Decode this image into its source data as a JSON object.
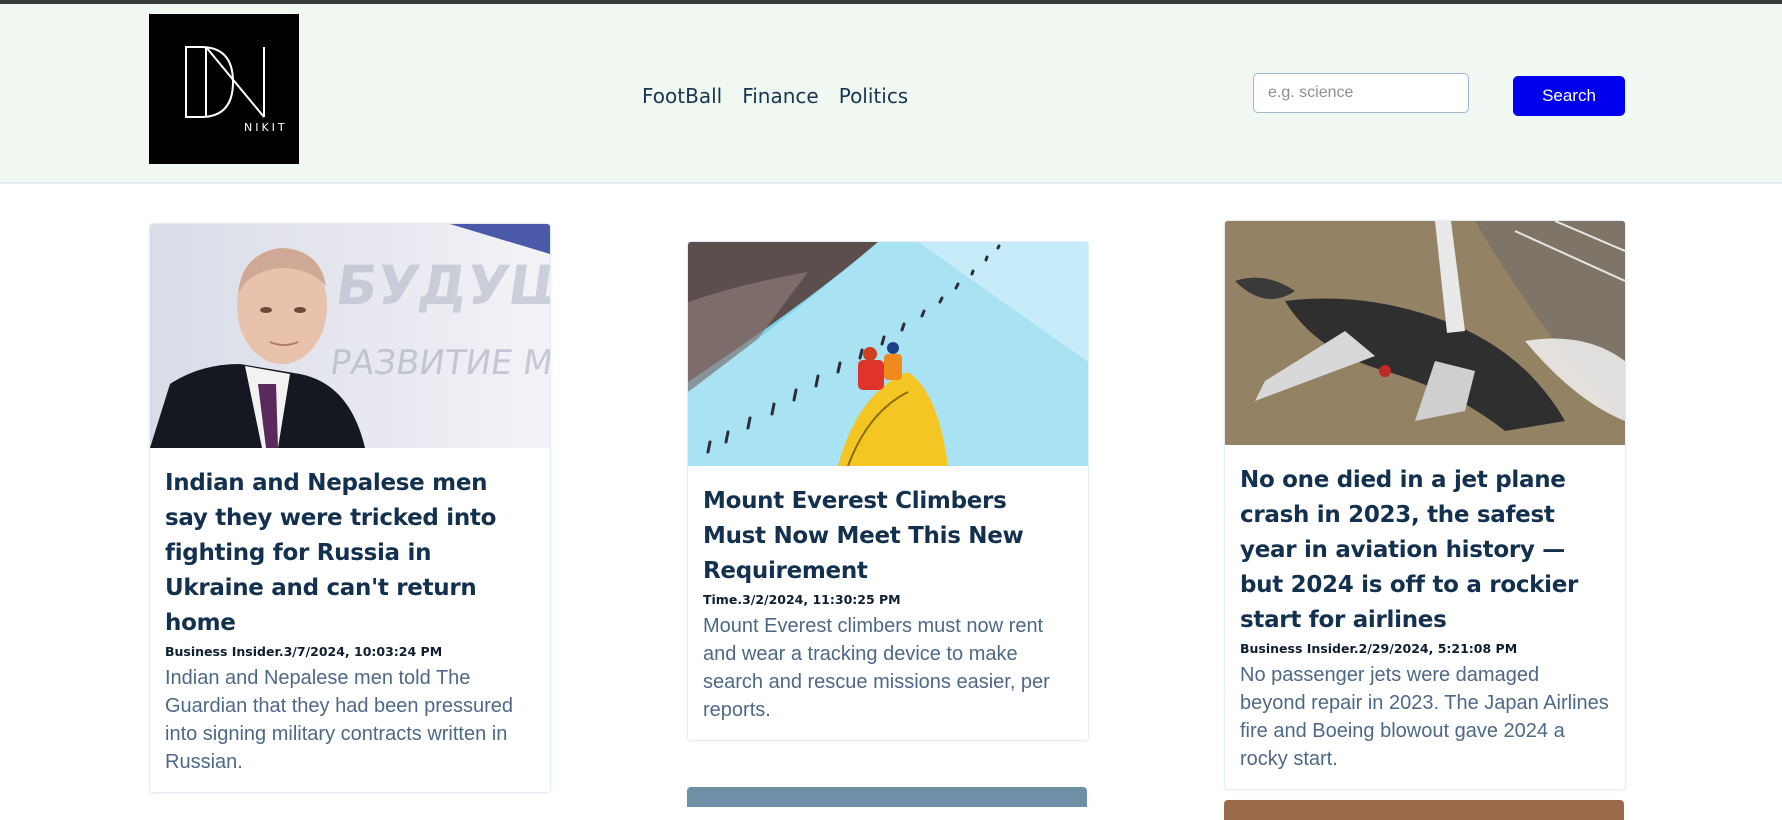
{
  "header": {
    "logo": {
      "text": "NIKIT",
      "icon": "dn-monogram-logo"
    },
    "nav": [
      "FootBall",
      "Finance",
      "Politics"
    ],
    "search": {
      "placeholder": "e.g. science",
      "value": "",
      "button_label": "Search"
    }
  },
  "articles": [
    {
      "title": "Indian and Nepalese men say they were tricked into fighting for Russia in Ukraine and can't return home",
      "meta": "Business Insider.3/7/2024, 10:03:24 PM",
      "description": "Indian and Nepalese men told The Guardian that they had been pressured into signing military contracts written in Russian.",
      "image": "portrait-of-man-in-suit"
    },
    {
      "title": "Mount Everest Climbers Must Now Meet This New Requirement",
      "meta": "Time.3/2/2024, 11:30:25 PM",
      "description": "Mount Everest climbers must now rent and wear a tracking device to make search and rescue missions easier, per reports.",
      "image": "climbers-on-snowy-mountain"
    },
    {
      "title": "No one died in a jet plane crash in 2023, the safest year in aviation history — but 2024 is off to a rockier start for airlines",
      "meta": "Business Insider.2/29/2024, 5:21:08 PM",
      "description": "No passenger jets were damaged beyond repair in 2023. The Japan Airlines fire and Boeing blowout gave 2024 a rocky start.",
      "image": "burned-airplane-wreckage"
    }
  ],
  "colors": {
    "header_bg": "#f1f8f1",
    "title": "#13304f",
    "description": "#4e6886",
    "search_button": "#0000ee"
  }
}
